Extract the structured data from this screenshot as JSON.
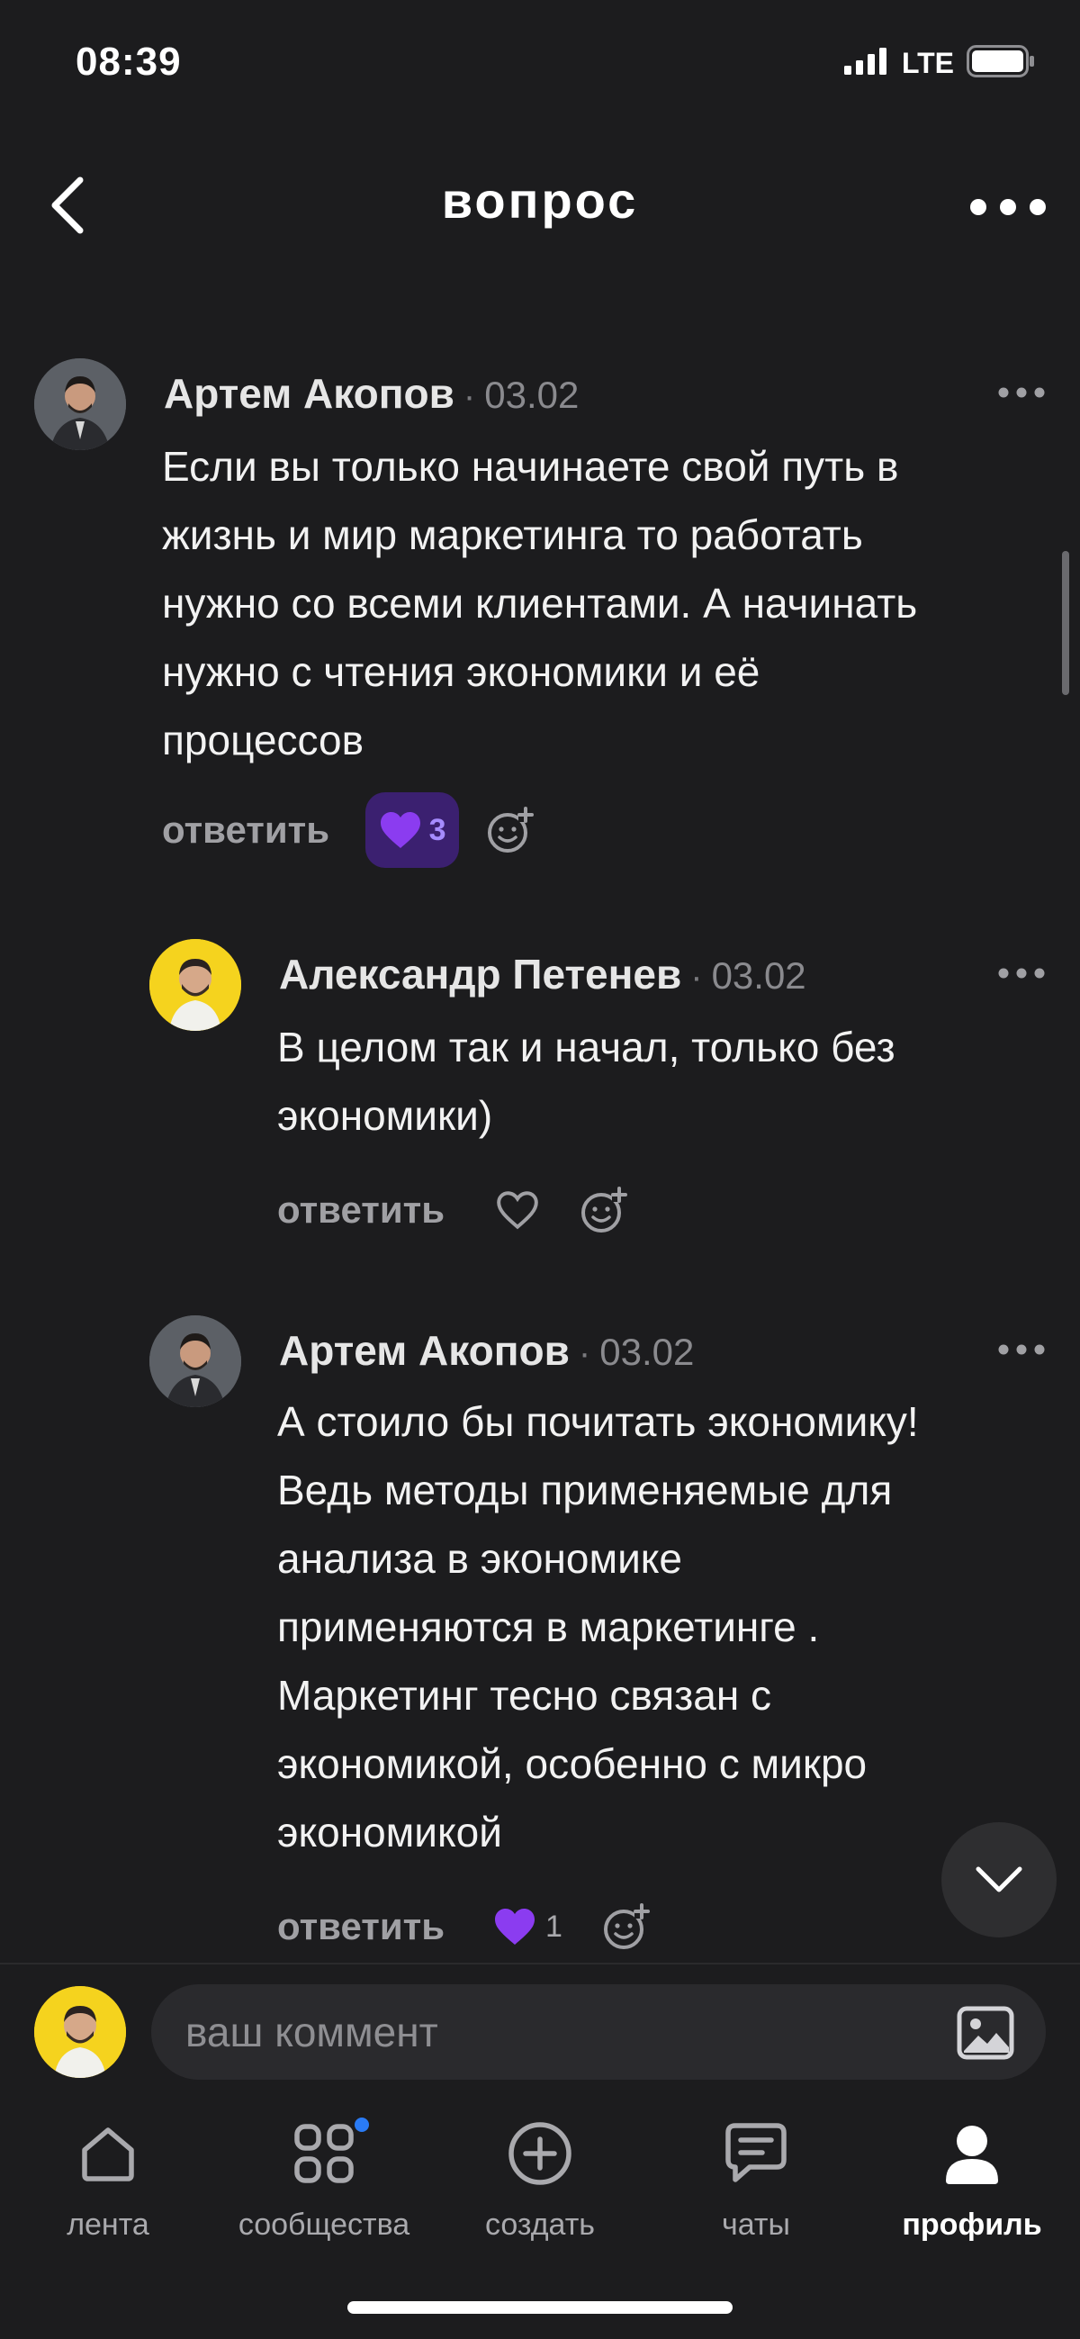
{
  "status_bar": {
    "time": "08:39",
    "network": "LTE"
  },
  "header": {
    "title": "вопрос"
  },
  "comments": [
    {
      "author": "Артем Акопов",
      "separator": "·",
      "date": "03.02",
      "lines": [
        "Если вы только начинаете свой путь в",
        "жизнь и мир маркетинга то работать",
        "нужно со всеми клиентами. А начинать",
        "нужно с чтения экономики и её",
        "процессов"
      ],
      "reply_label": "ответить",
      "likes": "3",
      "liked": true
    },
    {
      "author": "Александр Петенев",
      "separator": "·",
      "date": "03.02",
      "lines": [
        "В целом так и начал, только без",
        "экономики)"
      ],
      "reply_label": "ответить",
      "likes": "",
      "liked": false
    },
    {
      "author": "Артем Акопов",
      "separator": "·",
      "date": "03.02",
      "lines": [
        "А стоило бы почитать экономику!",
        "Ведь методы применяемые для",
        "анализа в экономике",
        "применяются в маркетинге  .",
        "Маркетинг тесно связан с",
        "экономикой, особенно с микро",
        "экономикой"
      ],
      "reply_label": "ответить",
      "likes": "1",
      "liked": true
    }
  ],
  "composer": {
    "placeholder": "ваш коммент"
  },
  "tabs": [
    {
      "label": "лента",
      "icon": "home-icon",
      "active": false
    },
    {
      "label": "сообщества",
      "icon": "grid-icon",
      "active": false,
      "badge": true
    },
    {
      "label": "создать",
      "icon": "plus-circle-icon",
      "active": false
    },
    {
      "label": "чаты",
      "icon": "chat-icon",
      "active": false
    },
    {
      "label": "профиль",
      "icon": "profile-icon",
      "active": true
    }
  ],
  "colors": {
    "background": "#1c1c1e",
    "like_accent": "#8b3cf0",
    "like_pill": "#3b2070",
    "notification_dot": "#2a7bf5",
    "avatar_yellow": "#f5d31e"
  }
}
